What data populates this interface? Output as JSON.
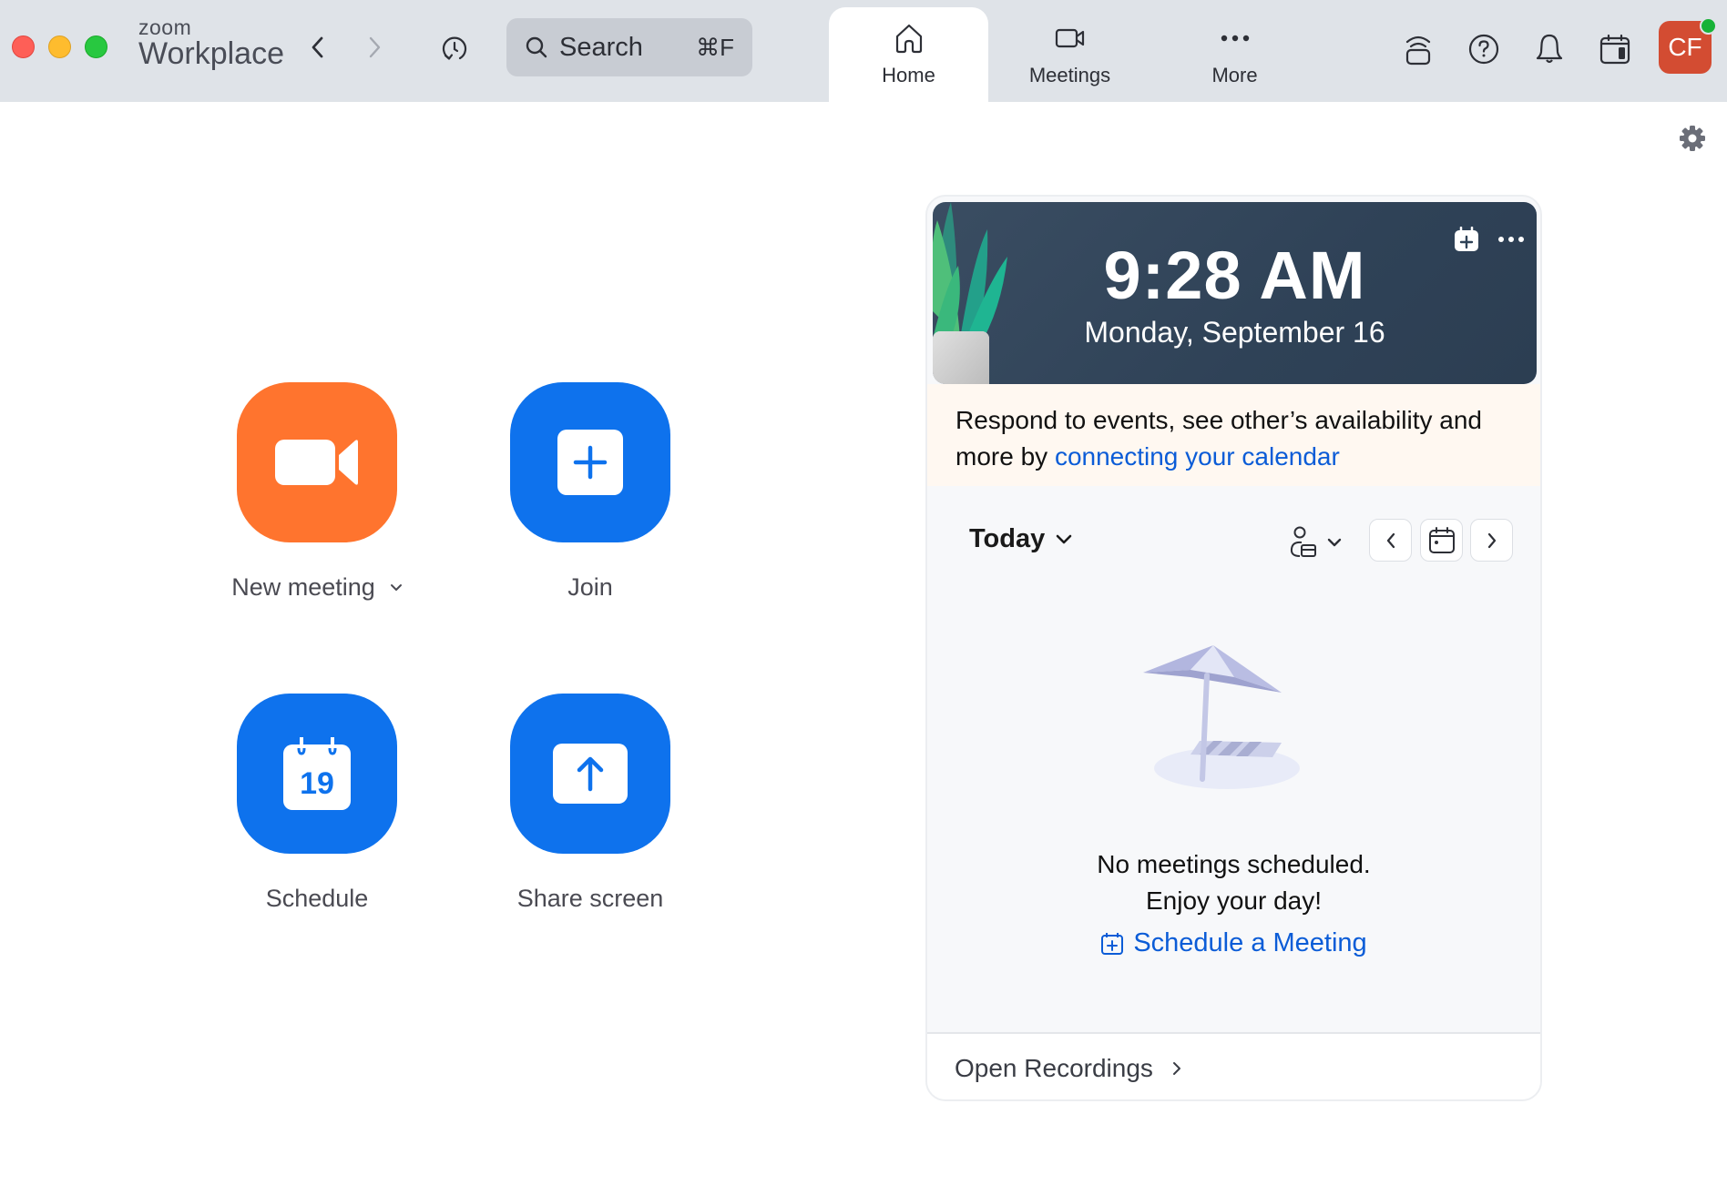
{
  "window": {
    "brand_small": "zoom",
    "brand_big": "Workplace"
  },
  "toolbar": {
    "search_label": "Search",
    "search_shortcut": "⌘F",
    "tabs": [
      {
        "label": "Home",
        "icon": "home-icon",
        "active": true
      },
      {
        "label": "Meetings",
        "icon": "video-camera-icon",
        "active": false
      },
      {
        "label": "More",
        "icon": "more-horizontal-icon",
        "active": false
      }
    ],
    "right_icons": [
      "room-signal-icon",
      "help-icon",
      "bell-icon",
      "calendar-icon"
    ],
    "avatar_initials": "CF",
    "avatar_status": "online"
  },
  "actions": [
    {
      "label": "New meeting",
      "icon": "video-camera-icon",
      "color": "#ff742e",
      "has_dropdown": true
    },
    {
      "label": "Join",
      "icon": "plus-icon",
      "color": "#0e72ed"
    },
    {
      "label": "Schedule",
      "icon": "calendar-icon",
      "icon_text": "19",
      "color": "#0e72ed"
    },
    {
      "label": "Share screen",
      "icon": "share-up-arrow-icon",
      "color": "#0e72ed"
    }
  ],
  "calendar": {
    "time": "9:28 AM",
    "date": "Monday, September 16",
    "banner_text": "Respond to events, see other’s availability and more by ",
    "banner_link": "connecting your calendar",
    "view_label": "Today",
    "empty_line1": "No meetings scheduled.",
    "empty_line2": "Enjoy your day!",
    "schedule_link": "Schedule a Meeting",
    "footer_link": "Open Recordings"
  },
  "colors": {
    "accent_blue": "#0e72ed",
    "accent_orange": "#ff742e",
    "link_blue": "#0b5cd7",
    "avatar_red": "#d34c32",
    "status_green": "#17b237"
  }
}
